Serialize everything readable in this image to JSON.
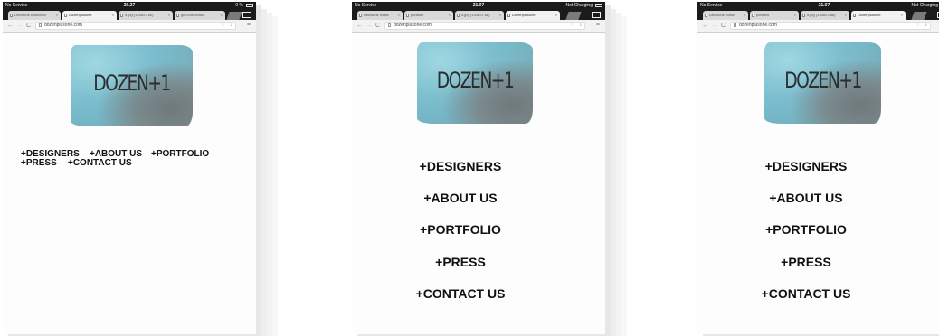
{
  "screens": [
    {
      "status": {
        "carrier": "No Service",
        "time": "20.27",
        "battery": "0 %"
      },
      "tabs": [
        "Deutsche Botschaft",
        "Dozenplusone",
        "5.jpg (1308×2 80)",
        "gm.com/dotdo"
      ],
      "active_tab": 1,
      "url": "dozenplusone.com",
      "logo": {
        "text": "DOZEN+1",
        "colors": {
          "blue": "#8ccfdd",
          "grey": "#767c7e"
        }
      },
      "nav": [
        "+DESIGNERS",
        "+ABOUT US",
        "+PORTFOLIO",
        "+PRESS",
        "+CONTACT US"
      ]
    },
    {
      "status": {
        "carrier": "No Service",
        "time": "21.07",
        "battery": "Not Charging"
      },
      "tabs": [
        "Deutsche Botsc",
        "portfolio",
        "5.jpg (1308×2 88)",
        "Dozenplusone"
      ],
      "active_tab": 3,
      "url": "dozenplusone.com",
      "logo": {
        "text": "DOZEN+1",
        "colors": {
          "blue": "#8ccfdd",
          "grey": "#767c7e"
        }
      },
      "nav": [
        "+DESIGNERS",
        "+ABOUT US",
        "+PORTFOLIO",
        "+PRESS",
        "+CONTACT US"
      ]
    },
    {
      "status": {
        "carrier": "No Service",
        "time": "21.07",
        "battery": "Not Charging"
      },
      "tabs": [
        "Deutsche Botsc",
        "portfolio",
        "5.jpg (1308×2 88)",
        "Dozenplusone"
      ],
      "active_tab": 3,
      "url": "dozenplusone.com",
      "logo": {
        "text": "DOZEN+1",
        "colors": {
          "blue": "#8ccfdd",
          "grey": "#767c7e"
        }
      },
      "nav": [
        "+DESIGNERS",
        "+ABOUT US",
        "+PORTFOLIO",
        "+PRESS",
        "+CONTACT US"
      ]
    }
  ],
  "icons": [
    "back-icon",
    "forward-icon",
    "reload-icon",
    "star-icon",
    "mic-icon",
    "menu-icon",
    "tabs-overview-icon"
  ]
}
